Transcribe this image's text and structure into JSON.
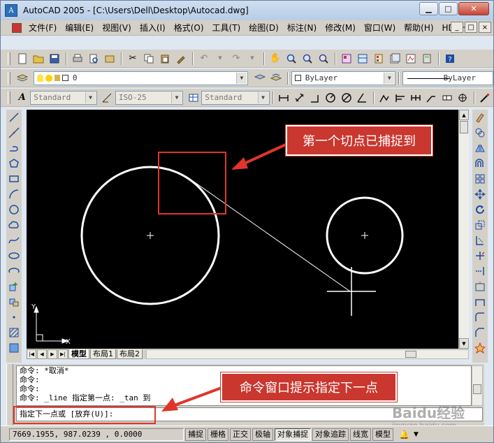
{
  "window": {
    "title": "AutoCAD 2005 - [C:\\Users\\Dell\\Desktop\\Autocad.dwg]",
    "icon": "autocad-app-icon",
    "min_label": "▁",
    "max_label": "□",
    "close_label": "✕"
  },
  "menu": {
    "items": [
      "文件(F)",
      "编辑(E)",
      "视图(V)",
      "插入(I)",
      "格式(O)",
      "工具(T)",
      "绘图(D)",
      "标注(N)",
      "修改(M)",
      "窗口(W)",
      "帮助(H)",
      "HDSHM"
    ],
    "mdi_min": "_",
    "mdi_max": "□",
    "mdi_close": "×"
  },
  "layer_toolbar": {
    "layer_value": "0",
    "color_value": "ByLayer",
    "linetype_value": "ByLayer"
  },
  "style_toolbar": {
    "text_style": "Standard",
    "dim_style": "ISO-25",
    "table_style": "Standard"
  },
  "tabs": {
    "items": [
      "模型",
      "布局1",
      "布局2"
    ],
    "active": "模型"
  },
  "command": {
    "history": [
      "命令: *取消*",
      "命令:",
      "命令:",
      "命令: _line 指定第一点: _tan 到"
    ],
    "prompt": "指定下一点或 [放弃(U)]:"
  },
  "status": {
    "coords": "7669.1955, 987.0239 , 0.0000",
    "buttons": [
      {
        "label": "捕捉",
        "on": false
      },
      {
        "label": "栅格",
        "on": false
      },
      {
        "label": "正交",
        "on": false
      },
      {
        "label": "极轴",
        "on": false
      },
      {
        "label": "对象捕捉",
        "on": true
      },
      {
        "label": "对象追踪",
        "on": false
      },
      {
        "label": "线宽",
        "on": false
      },
      {
        "label": "模型",
        "on": false
      }
    ]
  },
  "ucs": {
    "x_label": "X",
    "y_label": "Y"
  },
  "annotations": {
    "callout_tangent": "第一个切点已捕捉到",
    "callout_command": "命令窗口提示指定下一点"
  },
  "watermark": {
    "text": "Baidu经验",
    "sub": "jingyan.baidu.com"
  },
  "colors": {
    "callout_bg": "#c9372f",
    "highlight_box": "#e0352b",
    "canvas_bg": "#000000",
    "geometry": "#ffffff"
  }
}
